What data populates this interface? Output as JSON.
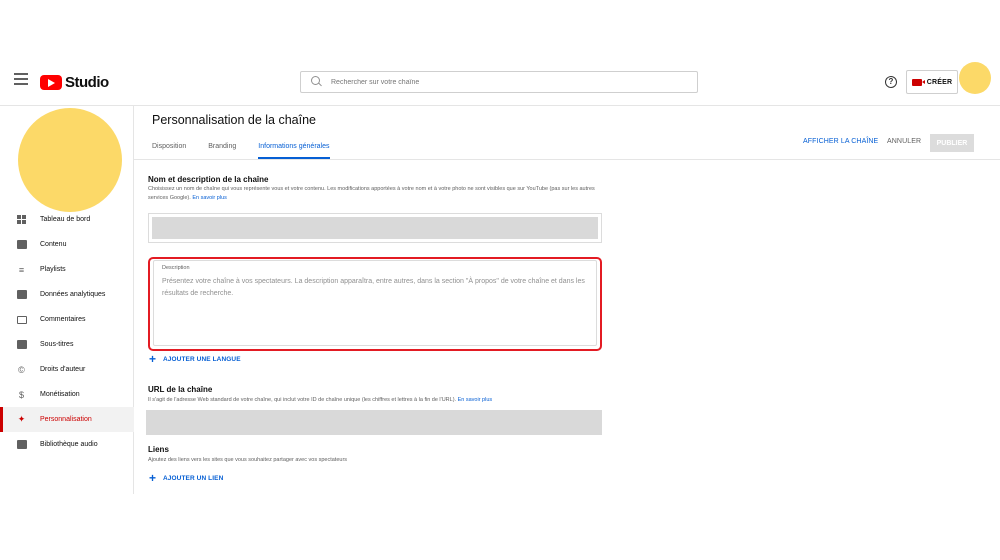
{
  "header": {
    "logo_text": "Studio",
    "search_placeholder": "Rechercher sur votre chaîne",
    "help_glyph": "?",
    "create_label": "CRÉER"
  },
  "sidebar": {
    "items": [
      {
        "label": "Tableau de bord",
        "icon": "dashboard-icon"
      },
      {
        "label": "Contenu",
        "icon": "content-icon"
      },
      {
        "label": "Playlists",
        "icon": "playlists-icon"
      },
      {
        "label": "Données analytiques",
        "icon": "analytics-icon"
      },
      {
        "label": "Commentaires",
        "icon": "comments-icon"
      },
      {
        "label": "Sous-titres",
        "icon": "subtitles-icon"
      },
      {
        "label": "Droits d'auteur",
        "icon": "copyright-icon"
      },
      {
        "label": "Monétisation",
        "icon": "monetization-icon"
      },
      {
        "label": "Personnalisation",
        "icon": "customization-icon",
        "active": true
      },
      {
        "label": "Bibliothèque audio",
        "icon": "audio-library-icon"
      }
    ]
  },
  "main": {
    "title": "Personnalisation de la chaîne",
    "tabs": [
      {
        "label": "Disposition"
      },
      {
        "label": "Branding"
      },
      {
        "label": "Informations générales",
        "active": true
      }
    ],
    "actions": {
      "view_channel": "AFFICHER LA CHAÎNE",
      "cancel": "ANNULER",
      "publish": "PUBLIER"
    },
    "name_section": {
      "title": "Nom et description de la chaîne",
      "subtitle": "Choisissez un nom de chaîne qui vous représente vous et votre contenu. Les modifications apportées à votre nom et à votre photo ne sont visibles que sur YouTube (pas sur les autres services Google).",
      "link": "En savoir plus"
    },
    "description": {
      "label": "Description",
      "placeholder": "Présentez votre chaîne à vos spectateurs. La description apparaîtra, entre autres, dans la section \"À propos\" de votre chaîne et dans les résultats de recherche."
    },
    "add_language": "AJOUTER UNE LANGUE",
    "url_section": {
      "title": "URL de la chaîne",
      "subtitle": "Il s'agit de l'adresse Web standard de votre chaîne, qui inclut votre ID de chaîne unique (les chiffres et lettres à la fin de l'URL).",
      "link": "En savoir plus"
    },
    "links_section": {
      "title": "Liens",
      "subtitle": "Ajoutez des liens vers les sites que vous souhaitez partager avec vos spectateurs"
    },
    "add_link": "AJOUTER UN LIEN"
  },
  "colors": {
    "accent": "#065fd4",
    "brand_red": "#ff0000",
    "highlight_border": "#e31b23",
    "avatar_placeholder": "#fcd968"
  }
}
